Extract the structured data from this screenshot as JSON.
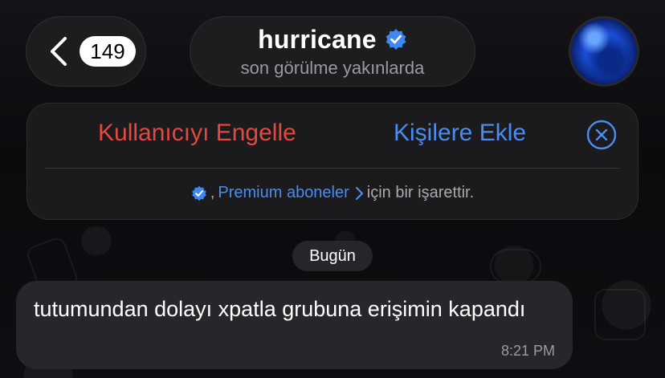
{
  "header": {
    "back": {
      "unread_count": "149",
      "icon": "chevron-left-icon"
    },
    "title": "hurricane",
    "title_badge_icon": "verified-badge-icon",
    "subtitle": "son görülme yakınlarda",
    "avatar_icon": "planet-avatar"
  },
  "action_panel": {
    "block_label": "Kullanıcıyı Engelle",
    "add_contact_label": "Kişilere Ekle",
    "close_icon": "close-circle-icon",
    "note": {
      "prefix": ",",
      "link_label": "Premium aboneler",
      "suffix": "için bir işarettir."
    }
  },
  "chat": {
    "date_label": "Bugün",
    "messages": [
      {
        "text": "tutumundan dolayı xpatla grubuna erişimin kapandı",
        "time": "8:21 PM"
      }
    ]
  },
  "colors": {
    "danger": "#e5483e",
    "accent": "#4a8cf0",
    "bubble": "#27272b",
    "background": "#0b0b0e"
  }
}
